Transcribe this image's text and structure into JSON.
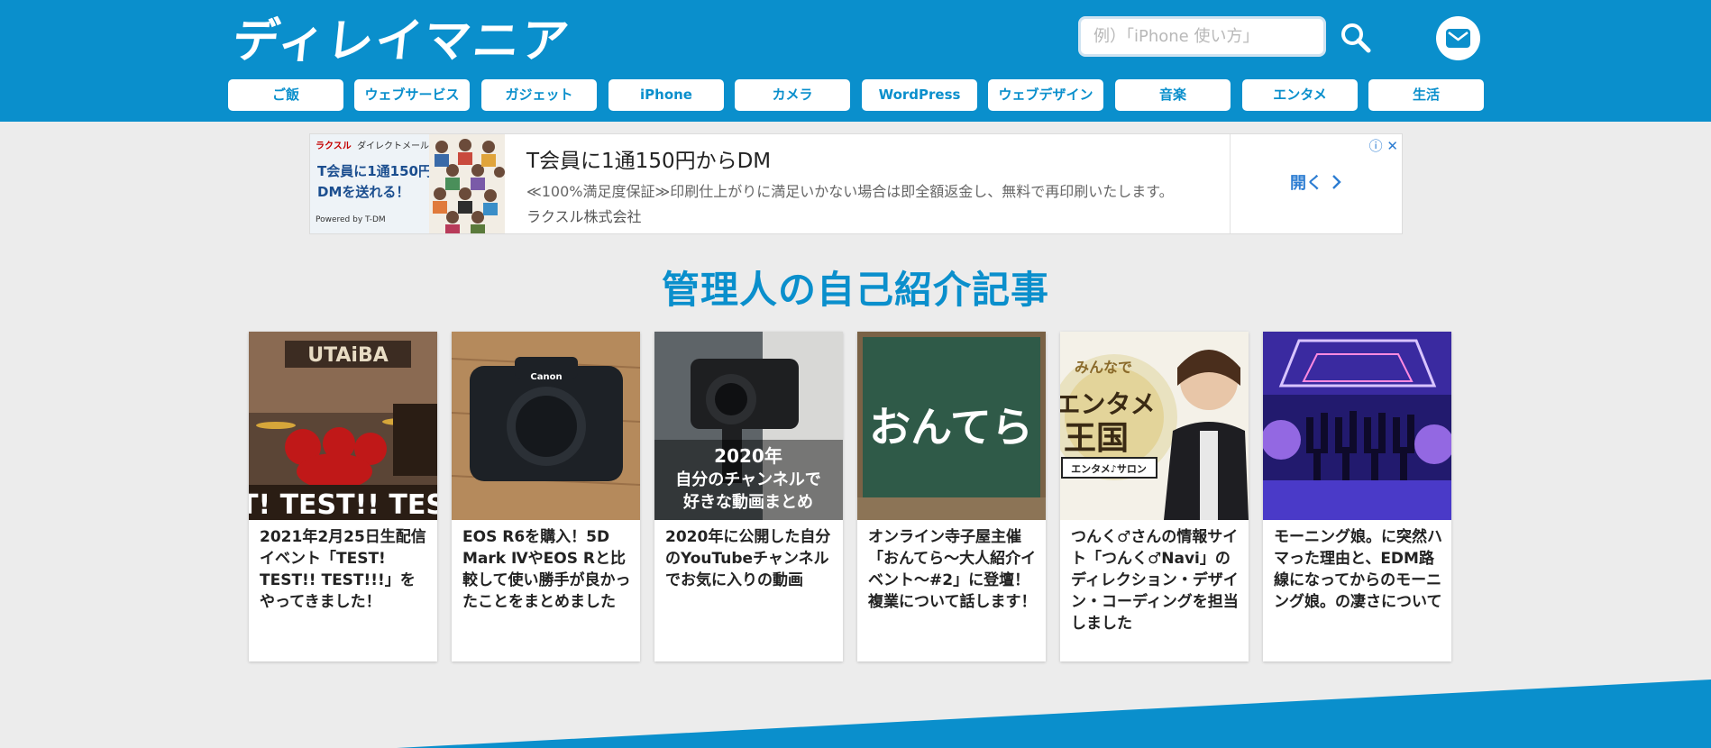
{
  "header": {
    "logo_text": "ディレイマニア",
    "search": {
      "placeholder": "例）「iPhone 使い方」",
      "value": ""
    },
    "search_icon": "search-icon",
    "mail_icon": "envelope-icon"
  },
  "nav": {
    "items": [
      {
        "label": "ご飯"
      },
      {
        "label": "ウェブサービス"
      },
      {
        "label": "ガジェット"
      },
      {
        "label": "iPhone"
      },
      {
        "label": "カメラ"
      },
      {
        "label": "WordPress"
      },
      {
        "label": "ウェブデザイン"
      },
      {
        "label": "音楽"
      },
      {
        "label": "エンタメ"
      },
      {
        "label": "生活"
      }
    ]
  },
  "ad": {
    "brand": "ラクスル",
    "brand_sub": "ダイレクトメール",
    "image_text_line1": "T会員に1通150円〜",
    "image_text_line2": "DMを送れる！",
    "image_powered": "Powered by  T-DM",
    "title": "T会員に1通150円からDM",
    "description": "≪100%満足度保証≫印刷仕上がりに満足いかない場合は即全額返金し、無料で再印刷いたします。",
    "company": "ラクスル株式会社",
    "open_label": "開く",
    "adchoices_icons": "ⓘ ✕"
  },
  "section": {
    "title": "管理人の自己紹介記事",
    "cards": [
      {
        "title": "2021年2月25日生配信イベント「TEST! TEST!! TEST!!!」をやってきました！",
        "thumb_text": "T! TEST!! TES",
        "thumb_logo": "UTAiBA"
      },
      {
        "title": "EOS R6を購入！5D Mark ⅣやEOS Rと比較して使い勝手が良かったことをまとめました",
        "thumb_text": "Canon"
      },
      {
        "title": "2020年に公開した自分のYouTubeチャンネルでお気に入りの動画",
        "thumb_text_line1": "2020年",
        "thumb_text_line2": "自分のチャンネルで",
        "thumb_text_line3": "好きな動画まとめ"
      },
      {
        "title": "オンライン寺子屋主催「おんてら〜大人紹介イベント〜#2」に登壇！複業について話します！",
        "thumb_text": "おんてら"
      },
      {
        "title": "つんく♂さんの情報サイト「つんく♂Navi」のディレクション・デザイン・コーディングを担当しました",
        "thumb_text_line1": "みんなで",
        "thumb_text_line2": "エンタメ",
        "thumb_text_line3": "王国",
        "thumb_text_line4": "エンタメ♪サロン"
      },
      {
        "title": "モーニング娘。に突然ハマった理由と、EDM路線になってからのモーニング娘。の凄さについて"
      }
    ]
  },
  "colors": {
    "brand_blue": "#0a8fcc",
    "background": "#ececec",
    "ad_link": "#2d7dd2"
  }
}
